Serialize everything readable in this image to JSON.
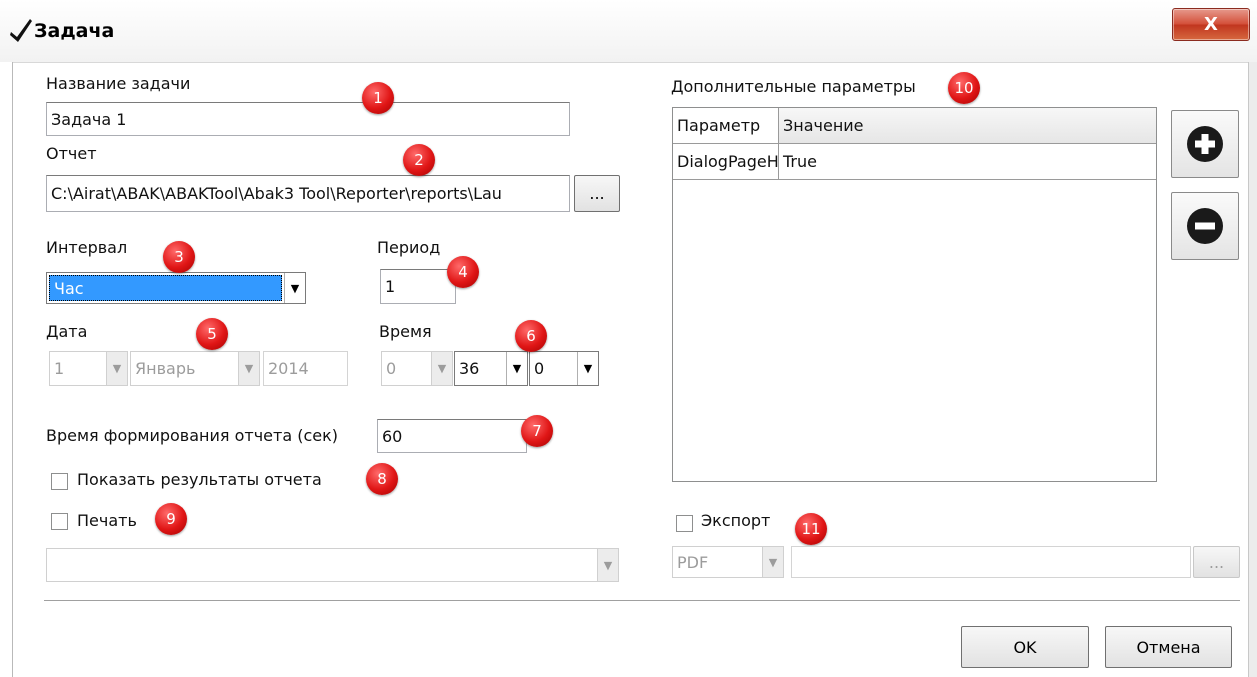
{
  "window": {
    "title": "Задача",
    "close_label": "X"
  },
  "task_name": {
    "label": "Название задачи",
    "value": "Задача 1"
  },
  "report": {
    "label": "Отчет",
    "path": "C:\\Airat\\ABAK\\ABAKTool\\Abak3 Tool\\Reporter\\reports\\Lau",
    "browse_label": "..."
  },
  "interval": {
    "label": "Интервал",
    "selected": "Час"
  },
  "period": {
    "label": "Период",
    "value": "1"
  },
  "date": {
    "label": "Дата",
    "day": "1",
    "month": "Январь",
    "year": "2014"
  },
  "time": {
    "label": "Время",
    "hour": "0",
    "minute": "36",
    "second": "0"
  },
  "report_time": {
    "label": "Время формирования отчета (сек)",
    "value": "60"
  },
  "show_results": {
    "label": "Показать результаты отчета",
    "checked": false
  },
  "print": {
    "label": "Печать",
    "checked": false,
    "printer": ""
  },
  "extra_params": {
    "label": "Дополнительные параметры",
    "columns": [
      "Параметр",
      "Значение"
    ],
    "rows": [
      {
        "name": "DialogPageH",
        "value": "True"
      }
    ]
  },
  "export": {
    "label": "Экспорт",
    "checked": false,
    "format": "PDF",
    "path": "",
    "browse_label": "..."
  },
  "buttons": {
    "ok": "OK",
    "cancel": "Отмена"
  },
  "badges": [
    "1",
    "2",
    "3",
    "4",
    "5",
    "6",
    "7",
    "8",
    "9",
    "10",
    "11"
  ],
  "colors": {
    "badge": "#e01616",
    "selection": "#3399ff",
    "close": "#c1361f"
  }
}
